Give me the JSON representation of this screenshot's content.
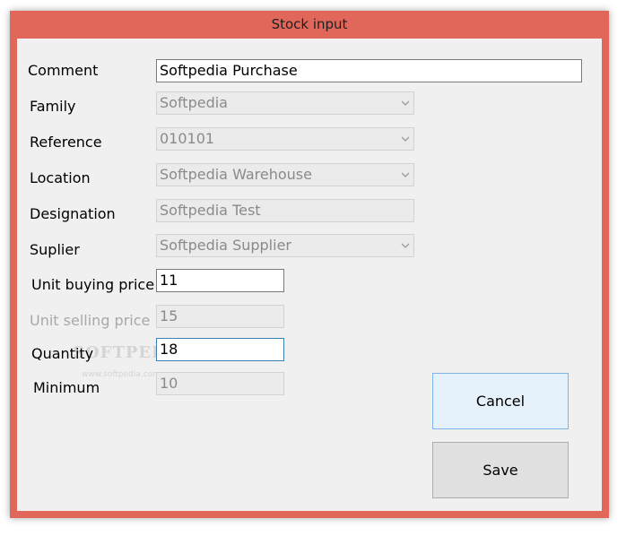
{
  "window": {
    "title": "Stock input"
  },
  "form": {
    "comment": {
      "label": "Comment",
      "value": "Softpedia Purchase"
    },
    "family": {
      "label": "Family",
      "value": "Softpedia"
    },
    "reference": {
      "label": "Reference",
      "value": "010101"
    },
    "location": {
      "label": "Location",
      "value": "Softpedia Warehouse"
    },
    "designation": {
      "label": "Designation",
      "value": "Softpedia Test"
    },
    "supplier": {
      "label": "Suplier",
      "value": "Softpedia Supplier"
    },
    "unit_buying_price": {
      "label": "Unit buying price",
      "value": "11"
    },
    "unit_selling_price": {
      "label": "Unit selling price",
      "value": "15"
    },
    "quantity": {
      "label": "Quantity",
      "value": "18"
    },
    "minimum": {
      "label": "Minimum",
      "value": "10"
    }
  },
  "buttons": {
    "cancel": "Cancel",
    "save": "Save"
  },
  "watermark": {
    "logo": "SOFTPEDIA",
    "url": "www.softpedia.com"
  },
  "icons": {
    "dropdown": "chevron-down-icon"
  },
  "colors": {
    "title_bar": "#e0675a",
    "client": "#f0f0f0",
    "focus_border": "#3c7fb1",
    "default_button": "#e5f1fb"
  }
}
